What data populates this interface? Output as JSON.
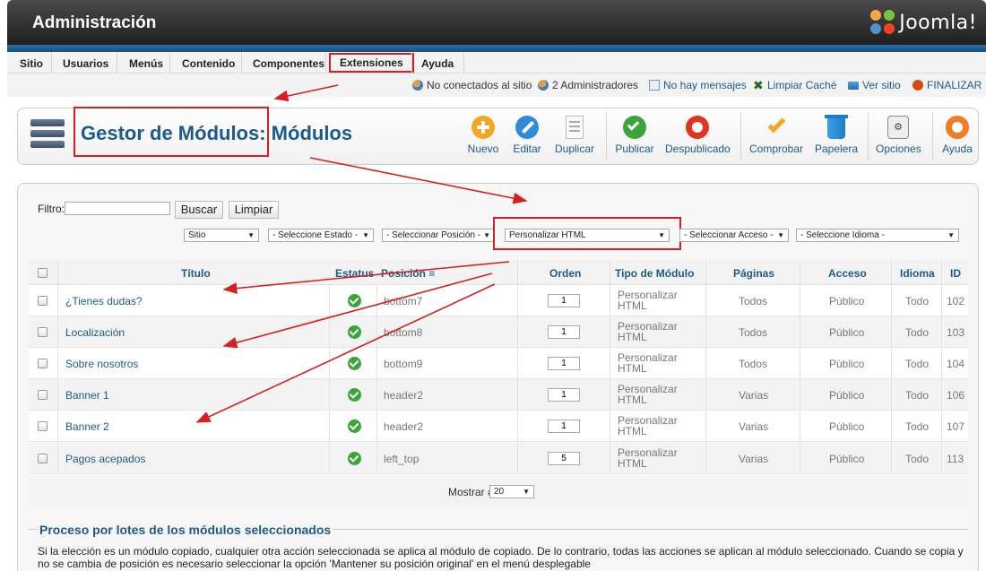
{
  "header": {
    "title": "Administración",
    "brand": "Joomla!"
  },
  "menu": {
    "items": [
      "Sitio",
      "Usuarios",
      "Menús",
      "Contenido",
      "Componentes",
      "Extensiones",
      "Ayuda"
    ],
    "active": "Extensiones"
  },
  "status": {
    "not_connected": "No conectados al sitio",
    "admins": "2 Administradores",
    "messages": "No hay mensajes",
    "clear_cache": "Limpiar Caché",
    "view_site": "Ver sitio",
    "logout": "FINALIZAR"
  },
  "toolbar": {
    "title": "Gestor de Módulos: Módulos",
    "buttons": {
      "new": "Nuevo",
      "edit": "Editar",
      "duplicate": "Duplicar",
      "publish": "Publicar",
      "unpublish": "Despublicado",
      "check": "Comprobar",
      "trash": "Papelera",
      "options": "Opciones",
      "help": "Ayuda"
    }
  },
  "filter": {
    "label": "Filtro:",
    "value": "",
    "search_button": "Buscar",
    "clear_button": "Limpiar",
    "selects": {
      "site": "Sitio",
      "state": "- Seleccione Estado -",
      "position": "- Seleccionar Posición -",
      "type": "Personalizar HTML",
      "access": "- Seleccionar Acceso -",
      "language": "- Seleccione Idioma -"
    }
  },
  "table": {
    "headers": {
      "title": "Título",
      "status": "Estatus",
      "position": "Posición",
      "order": "Orden",
      "type": "Tipo de Módulo",
      "pages": "Páginas",
      "access": "Acceso",
      "language": "Idioma",
      "id": "ID"
    },
    "rows": [
      {
        "title": "¿Tienes dudas?",
        "position": "bottom7",
        "order": "1",
        "type_line1": "Personalizar",
        "type_line2": "HTML",
        "pages": "Todos",
        "access": "Público",
        "language": "Todo",
        "id": "102"
      },
      {
        "title": "Localización",
        "position": "bottom8",
        "order": "1",
        "type_line1": "Personalizar",
        "type_line2": "HTML",
        "pages": "Todos",
        "access": "Público",
        "language": "Todo",
        "id": "103"
      },
      {
        "title": "Sobre nosotros",
        "position": "bottom9",
        "order": "1",
        "type_line1": "Personalizar",
        "type_line2": "HTML",
        "pages": "Todos",
        "access": "Público",
        "language": "Todo",
        "id": "104"
      },
      {
        "title": "Banner 1",
        "position": "header2",
        "order": "1",
        "type_line1": "Personalizar",
        "type_line2": "HTML",
        "pages": "Varias",
        "access": "Público",
        "language": "Todo",
        "id": "106"
      },
      {
        "title": "Banner 2",
        "position": "header2",
        "order": "1",
        "type_line1": "Personalizar",
        "type_line2": "HTML",
        "pages": "Varias",
        "access": "Público",
        "language": "Todo",
        "id": "107"
      },
      {
        "title": "Pagos acepados",
        "position": "left_top",
        "order": "5",
        "type_line1": "Personalizar",
        "type_line2": "HTML",
        "pages": "Varias",
        "access": "Público",
        "language": "Todo",
        "id": "113"
      }
    ]
  },
  "pagination": {
    "label": "Mostrar #",
    "value": "20"
  },
  "batch": {
    "title": "Proceso por lotes de los módulos seleccionados",
    "text": "Si la elección es un módulo copiado, cualquier otra acción seleccionada se aplica al módulo de copiado. De lo contrario, todas las acciones se aplican al módulo seleccionado. Cuando se copia y no se cambia de posición es necesario seleccionar la opción 'Mantener su posición original' en el menú desplegable"
  },
  "colors": {
    "accent": "#1d5a8c",
    "highlight": "#d62020",
    "published": "#3aa63a"
  }
}
